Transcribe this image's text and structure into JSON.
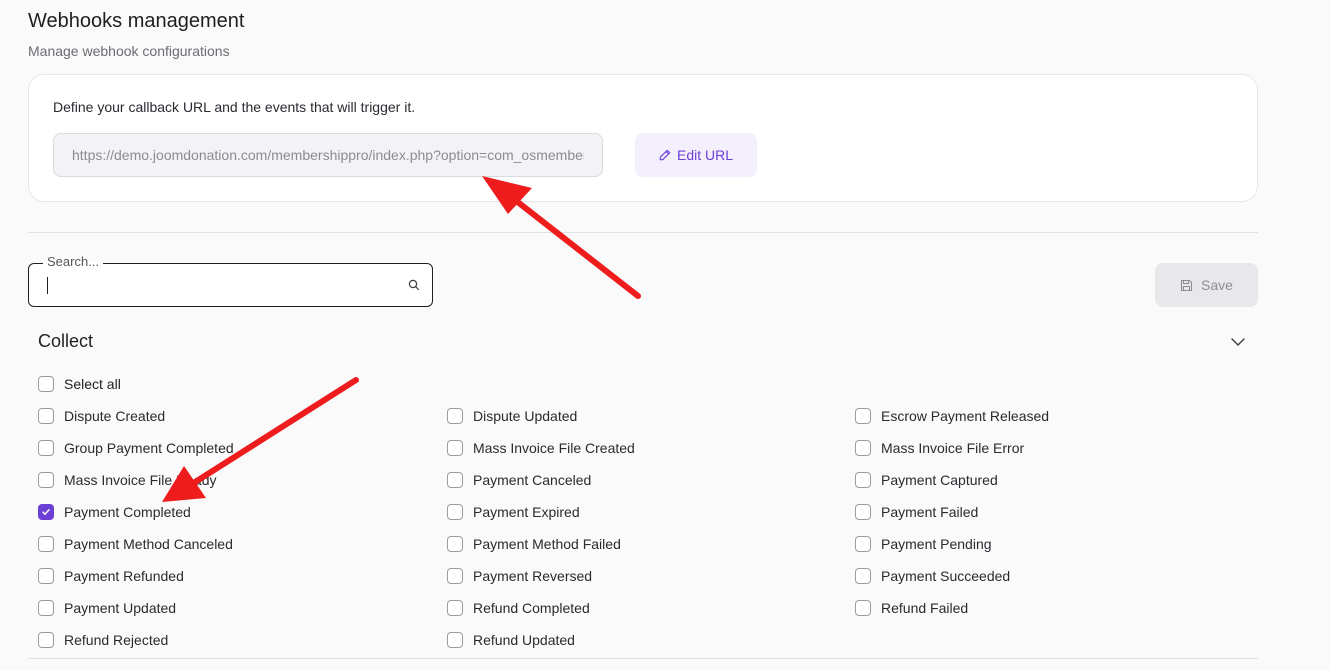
{
  "header": {
    "title": "Webhooks management",
    "subtitle": "Manage webhook configurations"
  },
  "url_card": {
    "description": "Define your callback URL and the events that will trigger it.",
    "url_value": "https://demo.joomdonation.com/membershippro/index.php?option=com_osmembership",
    "edit_label": "Edit URL",
    "edit_icon": "pencil-icon"
  },
  "search": {
    "label": "Search...",
    "value": "",
    "icon": "search-icon"
  },
  "save": {
    "label": "Save",
    "icon": "save-icon"
  },
  "section": {
    "title": "Collect",
    "toggle_icon": "chevron-down-icon",
    "select_all_label": "Select all",
    "select_all_checked": false
  },
  "events": {
    "columns": [
      [
        {
          "label": "Dispute Created",
          "checked": false
        },
        {
          "label": "Group Payment Completed",
          "checked": false
        },
        {
          "label": "Mass Invoice File Ready",
          "checked": false
        },
        {
          "label": "Payment Completed",
          "checked": true
        },
        {
          "label": "Payment Method Canceled",
          "checked": false
        },
        {
          "label": "Payment Refunded",
          "checked": false
        },
        {
          "label": "Payment Updated",
          "checked": false
        },
        {
          "label": "Refund Rejected",
          "checked": false
        }
      ],
      [
        {
          "label": "Dispute Updated",
          "checked": false
        },
        {
          "label": "Mass Invoice File Created",
          "checked": false
        },
        {
          "label": "Payment Canceled",
          "checked": false
        },
        {
          "label": "Payment Expired",
          "checked": false
        },
        {
          "label": "Payment Method Failed",
          "checked": false
        },
        {
          "label": "Payment Reversed",
          "checked": false
        },
        {
          "label": "Refund Completed",
          "checked": false
        },
        {
          "label": "Refund Updated",
          "checked": false
        }
      ],
      [
        {
          "label": "Escrow Payment Released",
          "checked": false
        },
        {
          "label": "Mass Invoice File Error",
          "checked": false
        },
        {
          "label": "Payment Captured",
          "checked": false
        },
        {
          "label": "Payment Failed",
          "checked": false
        },
        {
          "label": "Payment Pending",
          "checked": false
        },
        {
          "label": "Payment Succeeded",
          "checked": false
        },
        {
          "label": "Refund Failed",
          "checked": false
        }
      ]
    ]
  },
  "colors": {
    "accent": "#6b3fd6",
    "annotation_arrow": "#ee1c1c"
  }
}
